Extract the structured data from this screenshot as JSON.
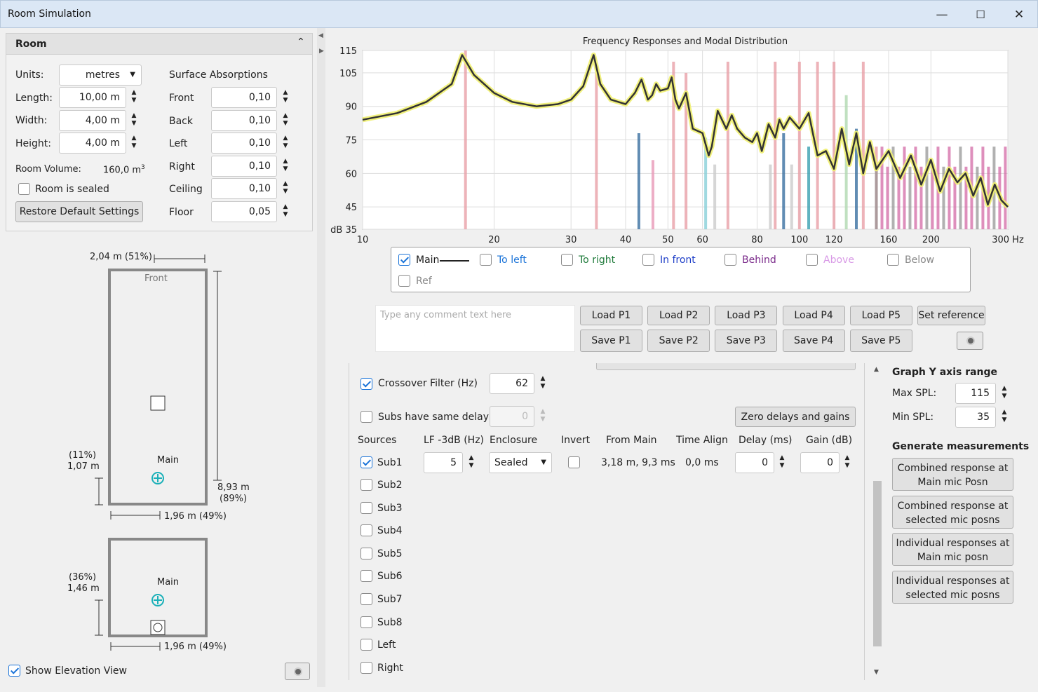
{
  "window": {
    "title": "Room Simulation"
  },
  "room": {
    "header": "Room",
    "units_label": "Units:",
    "units_value": "metres",
    "length_label": "Length:",
    "length_value": "10,00 m",
    "width_label": "Width:",
    "width_value": "4,00 m",
    "height_label": "Height:",
    "height_value": "4,00 m",
    "volume_label": "Room Volume:",
    "volume_value": "160,0 m",
    "volume_sup": "3",
    "sealed_label": "Room is sealed",
    "restore_label": "Restore Default Settings",
    "absorption_title": "Surface Absorptions",
    "surfaces": [
      {
        "label": "Front",
        "value": "0,10"
      },
      {
        "label": "Back",
        "value": "0,10"
      },
      {
        "label": "Left",
        "value": "0,10"
      },
      {
        "label": "Right",
        "value": "0,10"
      },
      {
        "label": "Ceiling",
        "value": "0,10"
      },
      {
        "label": "Floor",
        "value": "0,05"
      }
    ]
  },
  "plan": {
    "top_dim": "2,04 m (51%)",
    "front_label": "Front",
    "main_label": "Main",
    "left_pct": "(11%)",
    "left_dim": "1,07 m",
    "right_dim": "8,93 m",
    "right_pct": "(89%)",
    "bottom_dim": "1,96 m (49%)"
  },
  "elevation": {
    "main_label": "Main",
    "left_pct": "(36%)",
    "left_dim": "1,46 m",
    "bottom_dim": "1,96 m (49%)",
    "show_label": "Show Elevation View"
  },
  "chart_data": {
    "type": "line",
    "title": "Frequency Responses and Modal Distribution",
    "xscale": "log",
    "xlim": [
      10,
      300
    ],
    "ylim": [
      35,
      115
    ],
    "x_ticks": [
      "10",
      "20",
      "30",
      "40",
      "50",
      "60",
      "80",
      "100",
      "120",
      "160",
      "200",
      "300 Hz"
    ],
    "y_ticks": [
      "115",
      "105",
      "90",
      "75",
      "60",
      "45",
      "dB 35"
    ],
    "series": [
      {
        "name": "Main",
        "color": "#333333",
        "x": [
          10,
          12,
          14,
          16,
          16.9,
          18,
          20,
          22,
          25,
          28,
          30,
          32,
          33.8,
          35,
          37,
          40,
          42,
          43.5,
          45,
          46,
          47,
          48,
          50,
          51,
          52,
          53,
          55,
          57,
          60,
          62,
          63,
          65,
          68,
          70,
          72,
          75,
          78,
          80,
          82,
          85,
          88,
          90,
          92,
          95,
          100,
          105,
          110,
          115,
          120,
          125,
          130,
          135,
          140,
          145,
          150,
          160,
          170,
          180,
          190,
          200,
          210,
          220,
          230,
          240,
          250,
          260,
          270,
          280,
          290,
          300
        ],
        "values": [
          84,
          87,
          92,
          100,
          113,
          104,
          96,
          92,
          90,
          91,
          93,
          99,
          113,
          100,
          93,
          91,
          96,
          102,
          93,
          95,
          100,
          97,
          98,
          103,
          93,
          89,
          96,
          80,
          78,
          68,
          72,
          88,
          80,
          86,
          80,
          76,
          74,
          78,
          70,
          82,
          76,
          84,
          80,
          85,
          80,
          87,
          68,
          70,
          62,
          80,
          64,
          78,
          60,
          74,
          62,
          70,
          58,
          68,
          55,
          66,
          52,
          62,
          56,
          60,
          50,
          58,
          46,
          55,
          48,
          45
        ]
      }
    ],
    "legend": [
      "Main",
      "To left",
      "To right",
      "In front",
      "Behind",
      "Above",
      "Below",
      "Ref"
    ],
    "legend_colors": [
      "#1a1a1a",
      "#1a73d8",
      "#1e7a3a",
      "#1f3fc8",
      "#7a2a8a",
      "#d899e6",
      "#888888",
      "#888888"
    ]
  },
  "comment": {
    "placeholder": "Type any comment text here"
  },
  "presets": {
    "load": [
      "Load P1",
      "Load P2",
      "Load P3",
      "Load P4",
      "Load P5"
    ],
    "save": [
      "Save P1",
      "Save P2",
      "Save P3",
      "Save P4",
      "Save P5"
    ],
    "set_reference": "Set reference"
  },
  "subs": {
    "crossover_label": "Crossover Filter (Hz)",
    "crossover_value": "62",
    "same_delay_label": "Subs have same delay",
    "same_delay_value": "0",
    "zero_button": "Zero delays and gains",
    "headers": [
      "Sources",
      "LF -3dB (Hz)",
      "Enclosure",
      "Invert",
      "From Main",
      "Time Align",
      "Delay (ms)",
      "Gain (dB)"
    ],
    "sub1": {
      "label": "Sub1",
      "lf": "5",
      "enclosure": "Sealed",
      "from_main": "3,18 m, 9,3 ms",
      "time_align": "0,0 ms",
      "delay": "0",
      "gain": "0"
    },
    "sources": [
      "Sub2",
      "Sub3",
      "Sub4",
      "Sub5",
      "Sub6",
      "Sub7",
      "Sub8",
      "Left",
      "Right"
    ]
  },
  "graph_range": {
    "title": "Graph Y axis range",
    "max_label": "Max SPL:",
    "max_value": "115",
    "min_label": "Min SPL:",
    "min_value": "35"
  },
  "generate": {
    "title": "Generate measurements",
    "buttons": [
      [
        "Combined response at",
        "Main mic Posn"
      ],
      [
        "Combined response at",
        "selected mic posns"
      ],
      [
        "Individual responses at",
        "Main mic posn"
      ],
      [
        "Individual responses at",
        "selected mic posns"
      ]
    ]
  }
}
